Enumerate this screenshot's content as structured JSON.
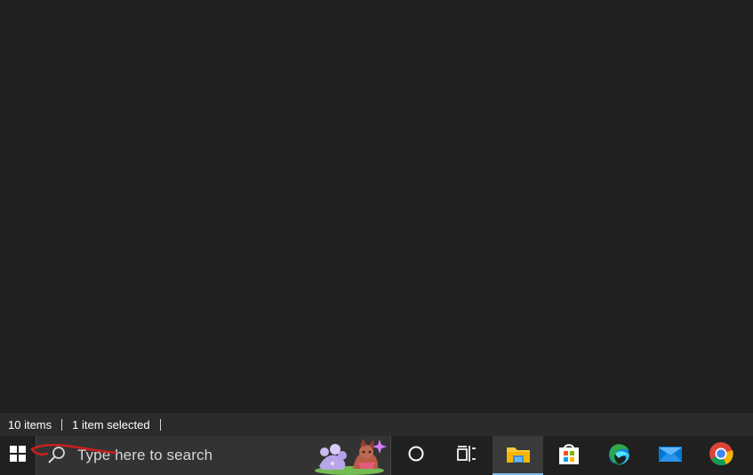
{
  "statusbar": {
    "item_count": "10 items",
    "selection": "1 item selected"
  },
  "taskbar": {
    "search_placeholder": "Type here to search",
    "icons": {
      "start": "windows-start-icon",
      "search": "search-icon",
      "search_highlight": "search-highlight-illustration",
      "cortana": "cortana-icon",
      "taskview": "task-view-icon",
      "file_explorer": "file-explorer-icon",
      "store": "microsoft-store-icon",
      "edge": "edge-icon",
      "mail": "mail-icon",
      "chrome": "chrome-icon"
    },
    "active_app": "file-explorer"
  },
  "annotation": {
    "color": "#cc1f1f"
  },
  "colors": {
    "background": "#202020",
    "statusbar": "#2b2b2b",
    "search_box": "#333333",
    "active_indicator": "#76b9ed"
  }
}
